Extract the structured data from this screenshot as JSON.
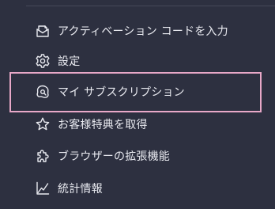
{
  "menu": {
    "items": [
      {
        "label": "アクティベーション コードを入力",
        "icon": "gift-envelope-icon"
      },
      {
        "label": "設定",
        "icon": "gear-icon"
      },
      {
        "label": "マイ サブスクリプション",
        "icon": "subscription-badge-icon"
      },
      {
        "label": "お客様特典を取得",
        "icon": "star-icon"
      },
      {
        "label": "ブラウザーの拡張機能",
        "icon": "puzzle-icon"
      },
      {
        "label": "統計情報",
        "icon": "chart-icon"
      }
    ],
    "highlighted_item": "マイ サブスクリプション"
  },
  "colors": {
    "background": "#2d3040",
    "text": "#e9eaf0",
    "highlight_border": "#e8a8c8",
    "divider": "#454859"
  }
}
